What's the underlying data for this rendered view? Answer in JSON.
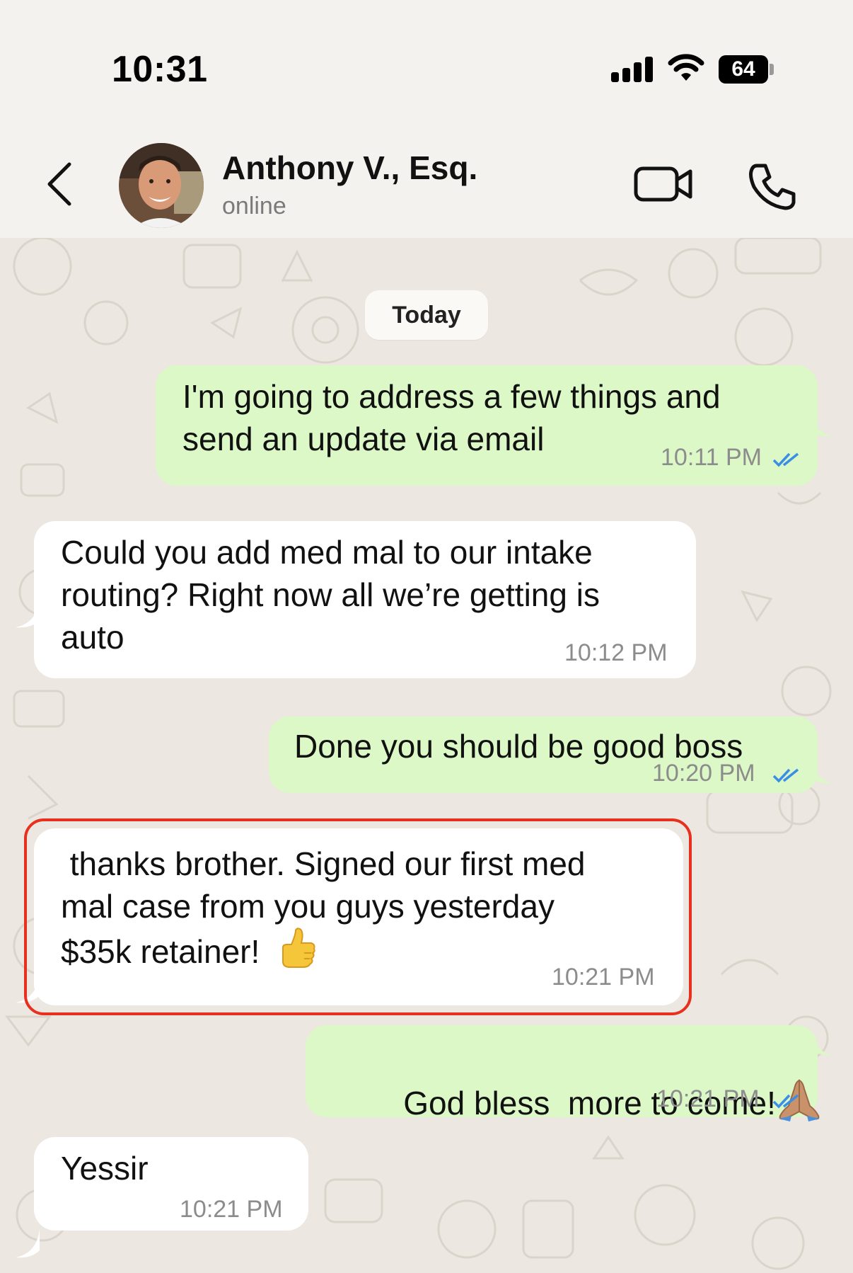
{
  "status_bar": {
    "time": "10:31",
    "battery": "64"
  },
  "header": {
    "contact_name": "Anthony V., Esq.",
    "contact_status": "online"
  },
  "chat": {
    "date_label": "Today",
    "messages": [
      {
        "direction": "outgoing",
        "text_line1": "I'm going to address a few things and",
        "text_line2": "send an update via email",
        "time": "10:11 PM",
        "read": true
      },
      {
        "direction": "incoming",
        "text_line1": "Could you add med mal to our intake",
        "text_line2": "routing? Right now all we’re getting is",
        "text_line3": "auto",
        "time": "10:12 PM"
      },
      {
        "direction": "outgoing",
        "text_line1": "Done you should be good boss",
        "time": "10:20 PM",
        "read": true
      },
      {
        "direction": "incoming",
        "text_line1": " thanks brother. Signed our first med",
        "text_line2": "mal case from you guys yesterday",
        "text_line3": "$35k retainer!",
        "emoji": "thumbs-up",
        "time": "10:21 PM",
        "highlighted": true
      },
      {
        "direction": "outgoing",
        "text_line1": "God bless  more to come!",
        "emoji": "folded-hands",
        "time": "10:21 PM",
        "read": true
      },
      {
        "direction": "incoming",
        "text_line1": "Yessir",
        "time": "10:21 PM"
      }
    ]
  },
  "colors": {
    "outgoing_bubble": "#dbf8c6",
    "incoming_bubble": "#ffffff",
    "read_check": "#3a8ee6",
    "highlight_border": "#e8301f",
    "chat_background": "#ece7e0"
  },
  "icons": [
    "back-chevron-icon",
    "video-call-icon",
    "phone-icon",
    "signal-icon",
    "wifi-icon",
    "battery-icon",
    "double-check-icon"
  ]
}
